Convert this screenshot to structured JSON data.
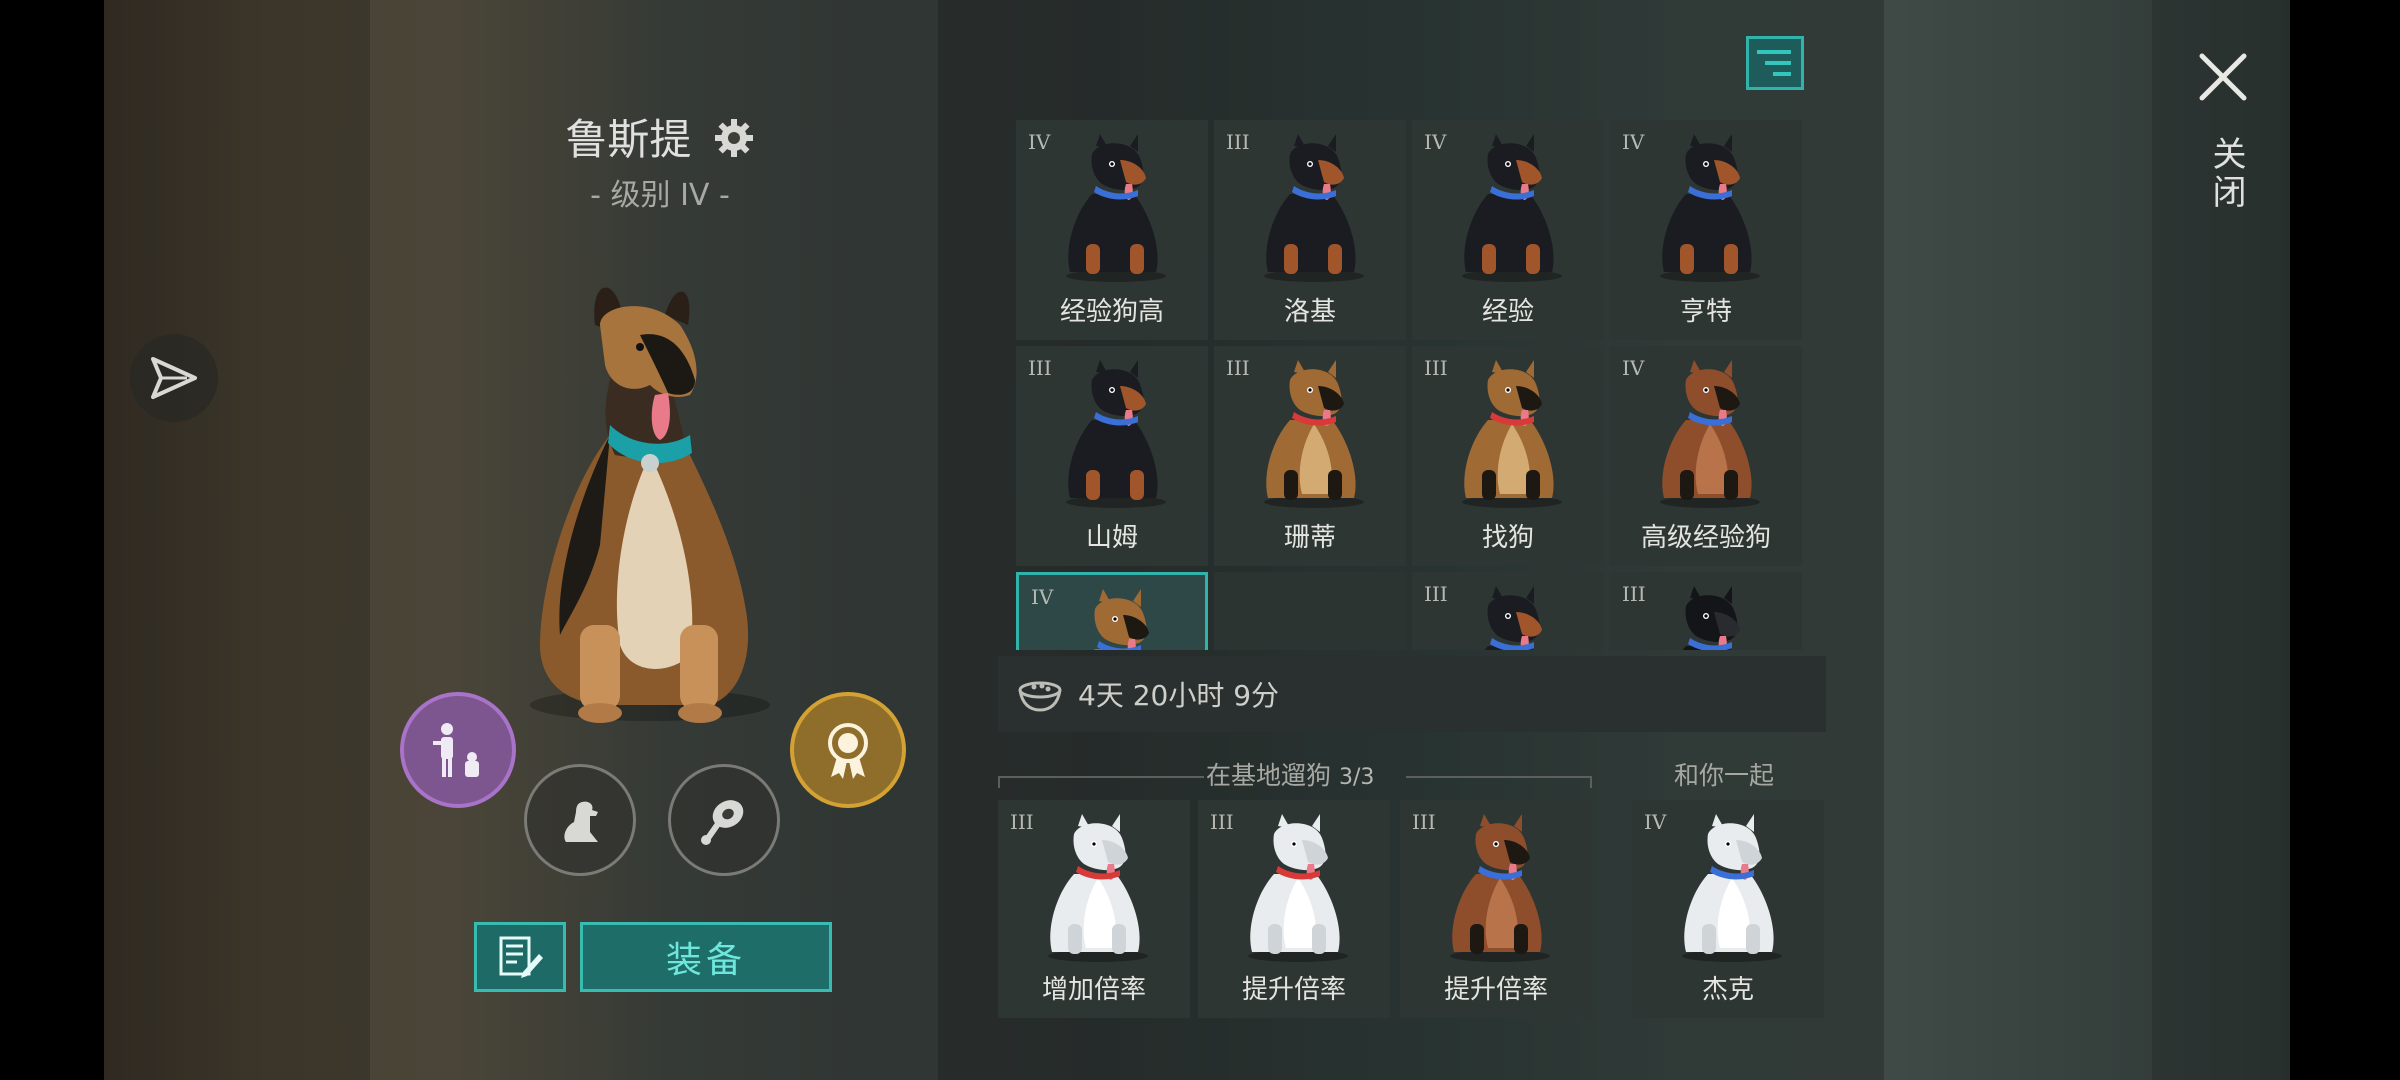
{
  "dog": {
    "name": "鲁斯提",
    "level": "- 级别 IV -"
  },
  "actions": {
    "equip": "装备"
  },
  "close_label": "关闭",
  "timer": "4天 20小时 9分",
  "grid": [
    {
      "tier": "IV",
      "name": "经验狗高",
      "breed": "rottweiler",
      "collar": "#3a6fd8"
    },
    {
      "tier": "III",
      "name": "洛基",
      "breed": "rottweiler",
      "collar": "#3a6fd8"
    },
    {
      "tier": "IV",
      "name": "经验",
      "breed": "rottweiler",
      "collar": "#3a6fd8"
    },
    {
      "tier": "IV",
      "name": "亨特",
      "breed": "rottweiler",
      "collar": "#3a6fd8"
    },
    {
      "tier": "III",
      "name": "山姆",
      "breed": "rottweiler",
      "collar": "#3a6fd8"
    },
    {
      "tier": "III",
      "name": "珊蒂",
      "breed": "shepherd",
      "collar": "#d83a3a"
    },
    {
      "tier": "III",
      "name": "找狗",
      "breed": "shepherd",
      "collar": "#d83a3a"
    },
    {
      "tier": "IV",
      "name": "高级经验狗",
      "breed": "shepherd-red",
      "collar": "#3a6fd8"
    },
    {
      "tier": "IV",
      "name": "",
      "breed": "shepherd",
      "collar": "#3a6fd8",
      "selected": true
    },
    {
      "tier": "",
      "name": "",
      "breed": "none",
      "collar": ""
    },
    {
      "tier": "III",
      "name": "",
      "breed": "rottweiler",
      "collar": "#3a6fd8"
    },
    {
      "tier": "III",
      "name": "",
      "breed": "black",
      "collar": "#3a6fd8"
    }
  ],
  "base_section": {
    "label": "在基地遛狗",
    "count": "3/3"
  },
  "with_you_section": {
    "label": "和你一起"
  },
  "base_dogs": [
    {
      "tier": "III",
      "name": "增加倍率",
      "breed": "husky",
      "collar": "#d83a3a"
    },
    {
      "tier": "III",
      "name": "提升倍率",
      "breed": "husky",
      "collar": "#d83a3a"
    },
    {
      "tier": "III",
      "name": "提升倍率",
      "breed": "shepherd-red",
      "collar": "#3a6fd8"
    }
  ],
  "with_you_dog": {
    "tier": "IV",
    "name": "杰克",
    "breed": "husky",
    "collar": "#3a6fd8"
  },
  "colors": {
    "accent": "#2fb3ab",
    "purple": "#a873c8",
    "gold": "#d3a233"
  }
}
